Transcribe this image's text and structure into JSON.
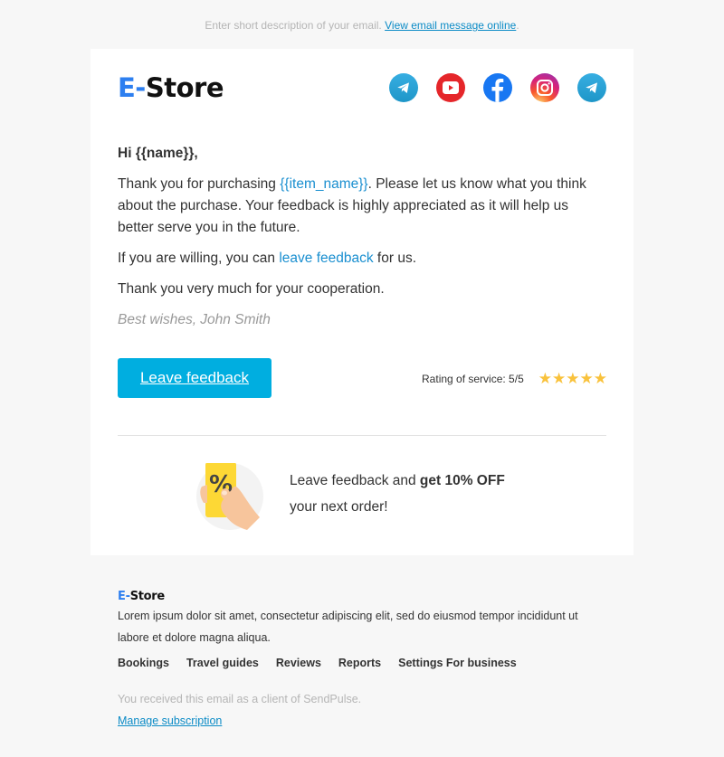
{
  "preheader": {
    "text": "Enter short description of your email.",
    "link": "View email message online",
    "suffix": "."
  },
  "header": {
    "logo_prefix": "E-",
    "logo_main": "Store",
    "socials": [
      {
        "name": "telegram",
        "icon": "telegram-icon"
      },
      {
        "name": "youtube",
        "icon": "youtube-icon"
      },
      {
        "name": "facebook",
        "icon": "facebook-icon"
      },
      {
        "name": "instagram",
        "icon": "instagram-icon"
      },
      {
        "name": "telegram",
        "icon": "telegram-icon"
      }
    ]
  },
  "content": {
    "greeting": "Hi {{name}},",
    "p1_before": "Thank you for purchasing ",
    "p1_link": "{{item_name}}",
    "p1_after": ". Please let us know what you think about the purchase. Your feedback is highly appreciated as it will help us better serve you in the future.",
    "p2_before": "If you are willing, you can ",
    "p2_link": "leave feedback",
    "p2_after": " for us.",
    "p3": "Thank you very much for your cooperation.",
    "signature": "Best wishes, John Smith"
  },
  "cta": {
    "button_label": "Leave feedback",
    "rating_label": "Rating of service: 5/5",
    "rating_value": 5,
    "rating_max": 5,
    "star_glyph": "★"
  },
  "promo": {
    "text_before": "Leave feedback and ",
    "text_bold": "get 10% OFF",
    "text_line2": "your next order!"
  },
  "footer": {
    "logo_prefix": "E-",
    "logo_main": "Store",
    "description": "Lorem ipsum dolor sit amet, consectetur adipiscing elit, sed do eiusmod tempor incididunt ut labore et dolore magna aliqua.",
    "nav": [
      "Bookings",
      "Travel guides",
      "Reviews",
      "Reports",
      "Settings For business"
    ],
    "note": "You received this email as a client of SendPulse.",
    "manage_link": "Manage subscription"
  },
  "colors": {
    "accent": "#00aee0",
    "link": "#1a8fd0",
    "star": "#f9c23c",
    "logo_blue": "#2d7ff0"
  }
}
